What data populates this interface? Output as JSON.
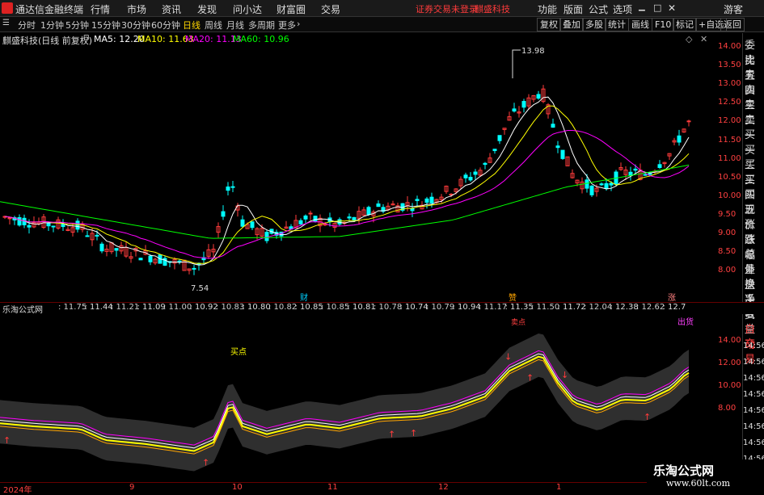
{
  "app": {
    "title": "通达信金融终端"
  },
  "menu": {
    "items": [
      "行情",
      "市场",
      "资讯",
      "发现",
      "问小达",
      "财富圈",
      "交易"
    ],
    "notice": "证券交易未登录",
    "stock_name": "麒盛科技",
    "right": [
      "功能",
      "版面",
      "公式",
      "选项"
    ],
    "user": "游客"
  },
  "tabs": {
    "items": [
      "分时",
      "1分钟",
      "5分钟",
      "15分钟",
      "30分钟",
      "60分钟",
      "日线",
      "周线",
      "月线",
      "多周期",
      "更多"
    ],
    "active": "日线"
  },
  "toolbar": {
    "right": [
      "复权",
      "叠加",
      "多股",
      "统计",
      "画线",
      "F10",
      "标记",
      "+自选",
      "返回"
    ]
  },
  "info": {
    "title": "麒盛科技(日线 前复权)",
    "ma5": "MA5: 12.20",
    "ma10": "MA10: 11.63",
    "ma20": "MA20: 11.13",
    "ma60": "MA60: 10.96"
  },
  "colors": {
    "ma5": "#ffffff",
    "ma10": "#ffff00",
    "ma20": "#ff00ff",
    "ma60": "#00ff00",
    "up": "#ff3b3b",
    "down": "#00ffff"
  },
  "price_axis": [
    "14.00",
    "13.50",
    "13.00",
    "12.50",
    "12.00",
    "11.50",
    "11.00",
    "10.50",
    "10.00",
    "9.50",
    "9.00",
    "8.50",
    "8.00"
  ],
  "annotations": {
    "high": "13.98",
    "low": "7.54",
    "m1": "财",
    "m2": "赞",
    "m3": "涨"
  },
  "side": [
    "委比",
    "卖五",
    "卖四",
    "卖三",
    "卖二",
    "卖一",
    "买一",
    "买二",
    "买三",
    "买四",
    "买五",
    "现价",
    "涨跌",
    "涨幅",
    "总量",
    "外盘",
    "换手",
    "净资",
    "收益",
    "自动",
    "交易"
  ],
  "lower": {
    "title": "乐淘公式网",
    "values": [
      ": 11.75",
      ": 11.44",
      ": 11.21",
      ": 11.09",
      ": 11.00",
      ": 10.92",
      ": 10.83",
      ": 10.80",
      ": 10.82",
      ": 10.85",
      ": 10.85",
      ": 10.81",
      ": 10.78",
      ": 10.74",
      ": 10.79",
      ": 10.94",
      ": 11.17",
      ": 11.35",
      ": 11.50",
      ": 11.72",
      ": 12.04",
      ": 12.38",
      ": 12.62",
      ": 12.7"
    ],
    "buy": "买点",
    "sell": "出货",
    "hi": "卖点"
  },
  "lower_axis": [
    "14.00",
    "12.00",
    "10.00",
    "8.00"
  ],
  "lower_axis_r": [
    "14:56",
    "14:56",
    "14:56",
    "14:56",
    "14:56",
    "14:56",
    "14:56",
    "14:56"
  ],
  "dates": [
    "2024年",
    "9",
    "10",
    "11",
    "12",
    "1"
  ],
  "watermark": {
    "line1": "乐淘公式网",
    "line2": "www.60lt.com"
  }
}
